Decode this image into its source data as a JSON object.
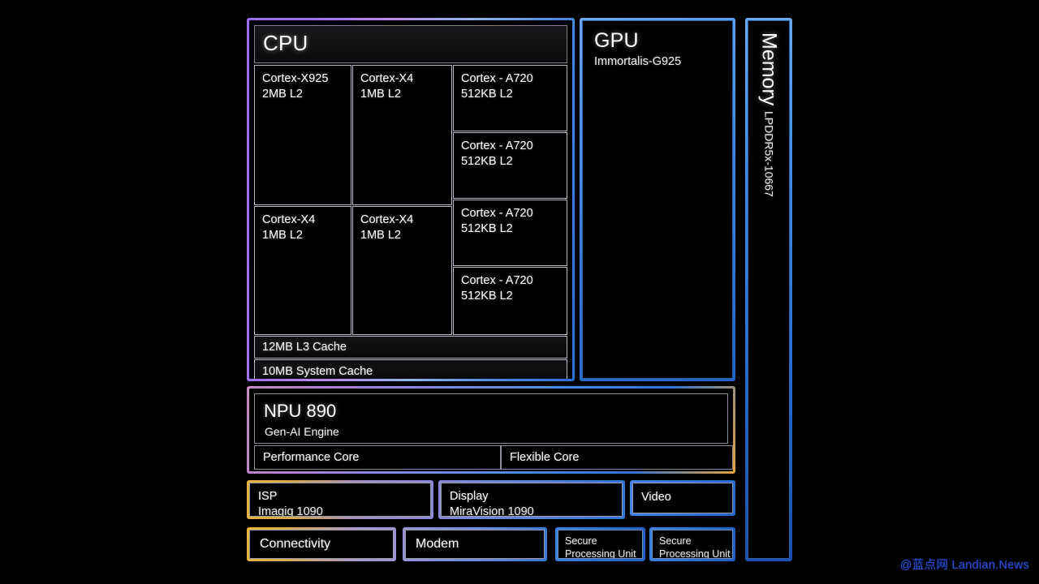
{
  "background_color": "#000000",
  "cpu": {
    "title": "CPU",
    "cores": [
      {
        "name": "Cortex-X925",
        "cache": "2MB L2"
      },
      {
        "name": "Cortex-X4",
        "cache": "1MB L2"
      },
      {
        "name": "Cortex-X4",
        "cache": "1MB L2"
      },
      {
        "name": "Cortex-X4",
        "cache": "1MB L2"
      },
      {
        "name": "Cortex - A720",
        "cache": "512KB L2"
      },
      {
        "name": "Cortex - A720",
        "cache": "512KB L2"
      },
      {
        "name": "Cortex - A720",
        "cache": "512KB L2"
      },
      {
        "name": "Cortex - A720",
        "cache": "512KB L2"
      }
    ],
    "l3_cache": "12MB L3 Cache",
    "system_cache": "10MB System Cache",
    "border_from": "#9a6ef0",
    "border_to": "#2b6fd4"
  },
  "gpu": {
    "title": "GPU",
    "subtitle": "Immortalis-G925",
    "border_from": "#6aa8f0",
    "border_to": "#1f63cc"
  },
  "memory": {
    "title": "Memory",
    "subtitle": "LPDDR5x-10667",
    "border_from": "#6aa8f0",
    "border_to": "#1b4fae"
  },
  "npu": {
    "title": "NPU 890",
    "subtitle": "Gen-AI Engine",
    "performance_core": "Performance Core",
    "flexible_core": "Flexible Core",
    "border_from": "#c98bc0",
    "border_to": "#e2a23c"
  },
  "media_row": [
    {
      "title": "ISP",
      "subtitle": "Imagiq 1090"
    },
    {
      "title": "Display",
      "subtitle": "MiraVision 1090"
    },
    {
      "title": "Video",
      "subtitle": ""
    }
  ],
  "bottom_row": [
    {
      "title": "Connectivity",
      "subtitle": ""
    },
    {
      "title": "Modem",
      "subtitle": ""
    },
    {
      "title": "Secure",
      "subtitle": "Processing Unit"
    },
    {
      "title": "Secure",
      "subtitle": "Processing Unit"
    }
  ],
  "watermark": "@蓝点网 Landian.News"
}
